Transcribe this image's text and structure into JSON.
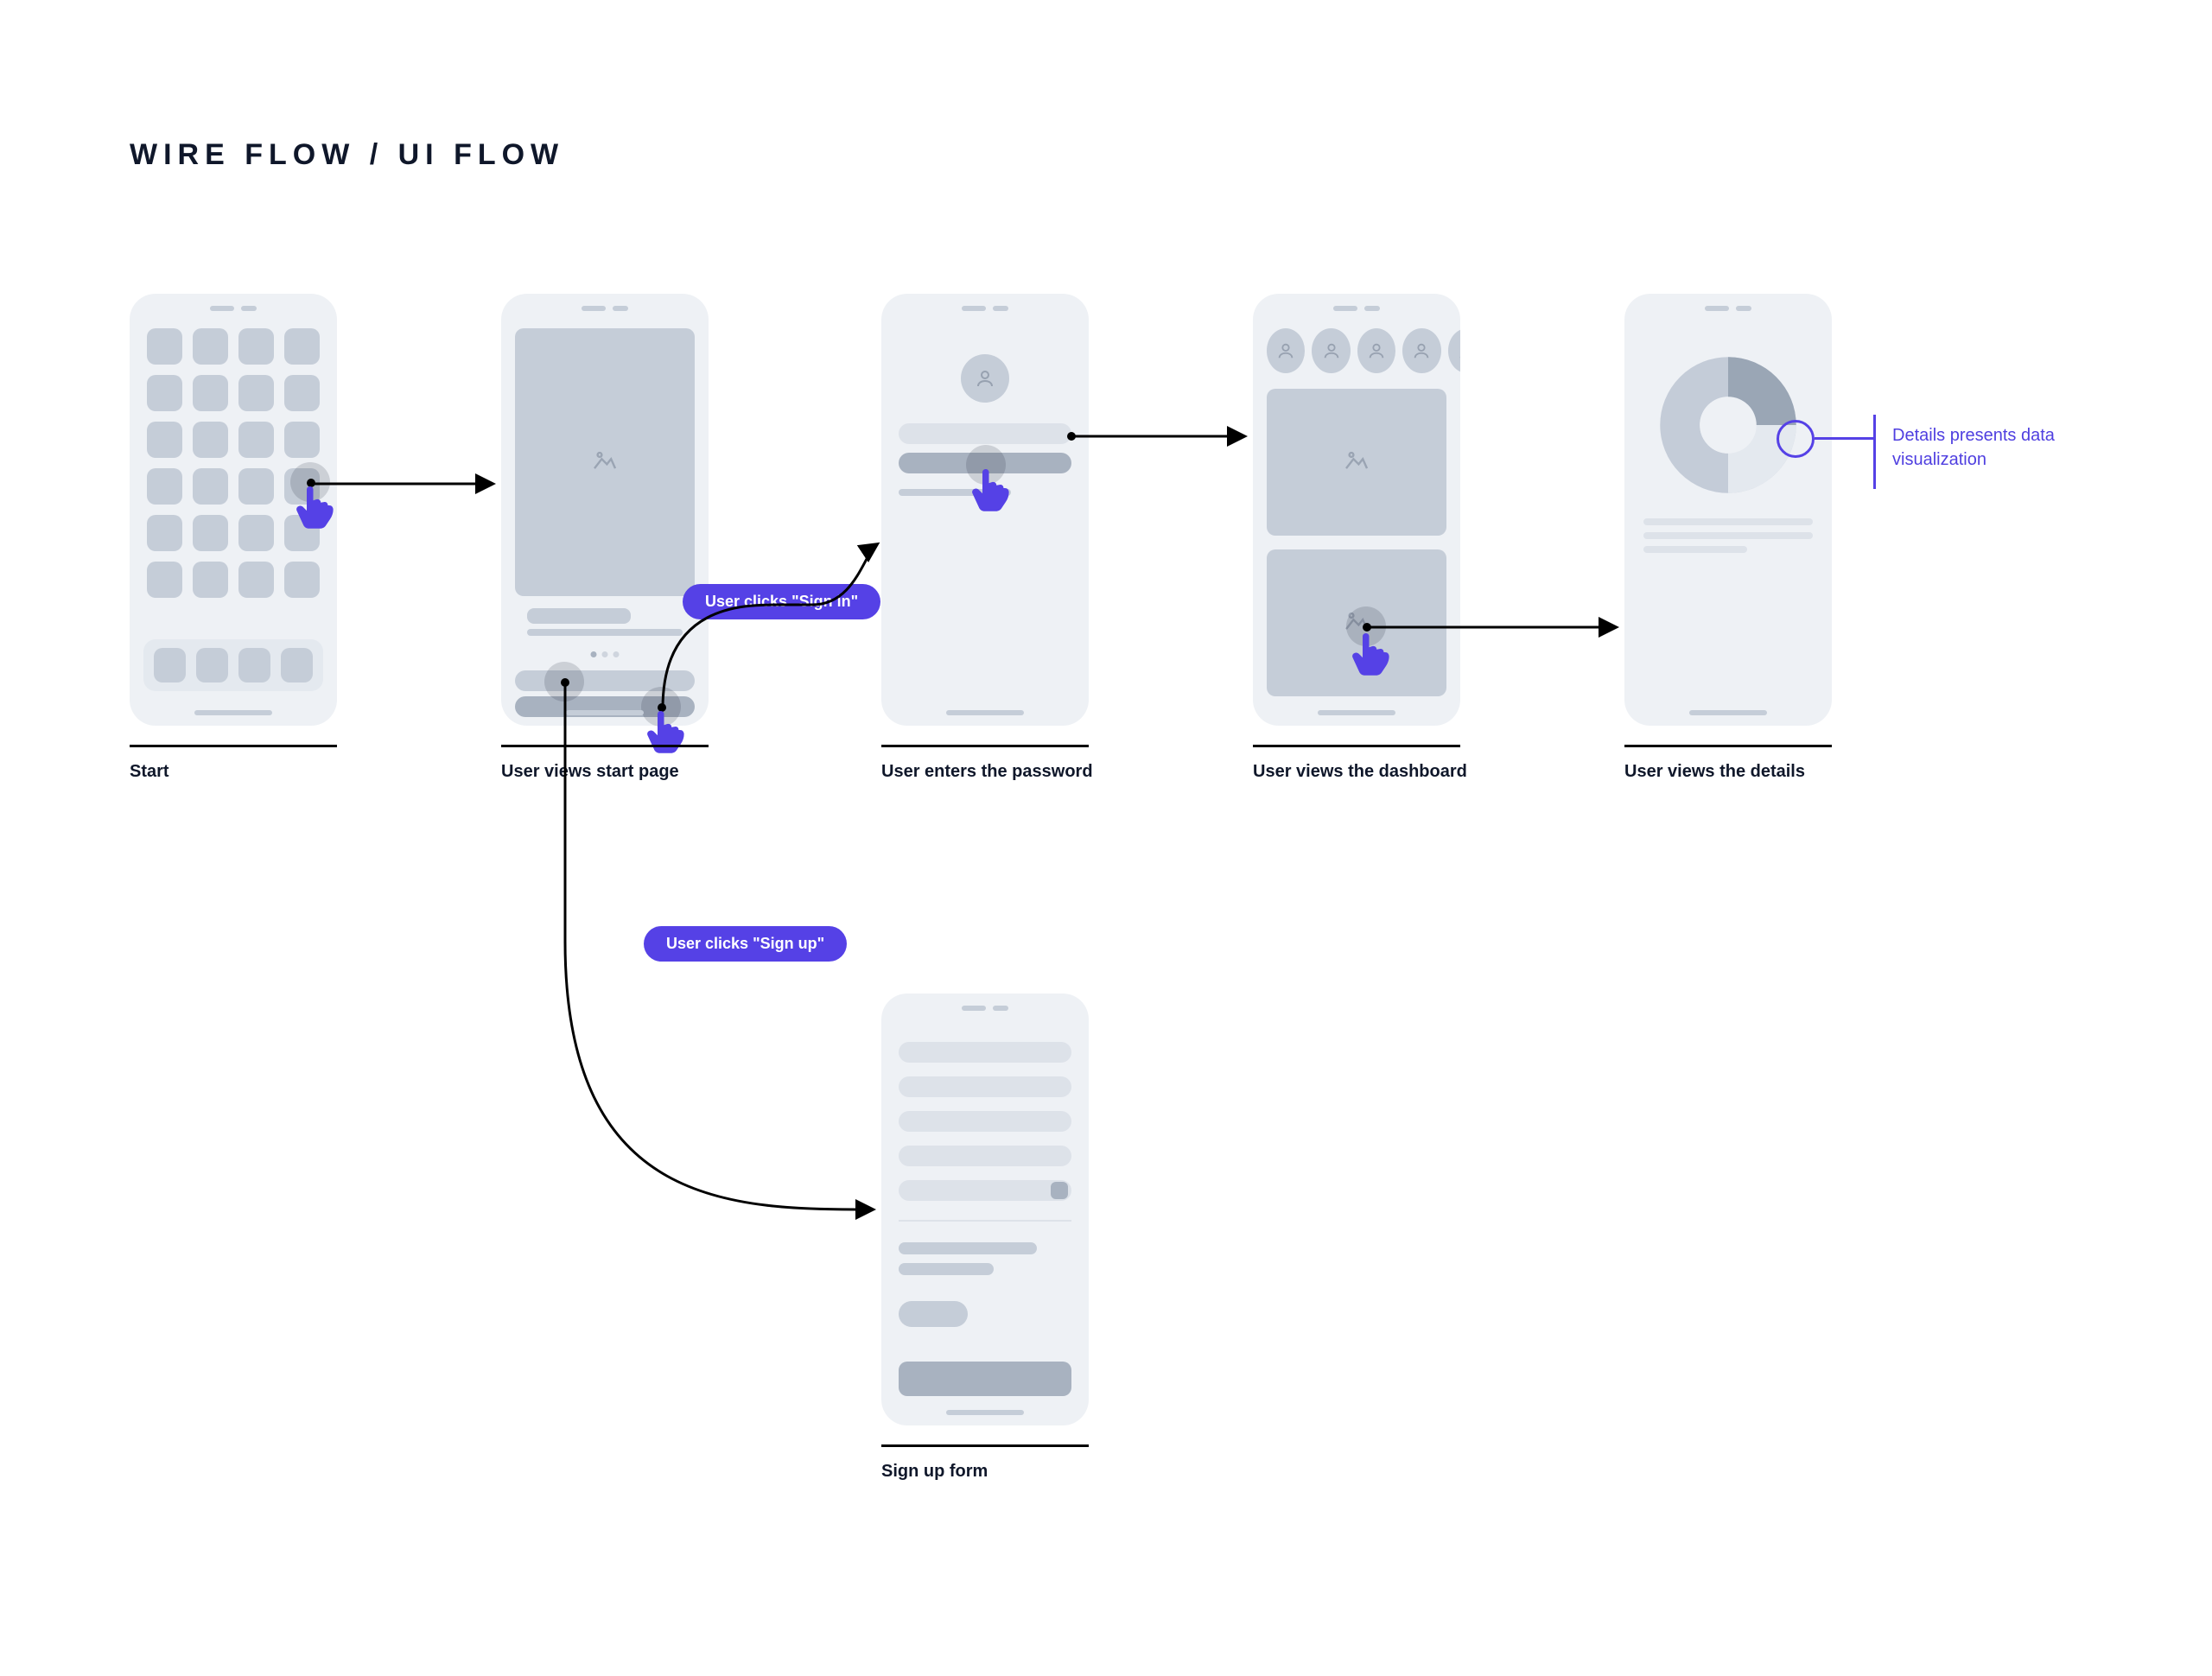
{
  "title": "WIRE FLOW / UI FLOW",
  "screens": {
    "s1": "Start",
    "s2": "User views start page",
    "s3": "User enters the password",
    "s4": "User views  the dashboard",
    "s5": "User views  the details",
    "s6": "Sign up form"
  },
  "actions": {
    "signin": "User clicks \"Sign in\"",
    "signup": "User clicks \"Sign up\""
  },
  "annotation": {
    "details": "Details presents data visualization"
  },
  "chart_data": {
    "type": "pie",
    "title": "",
    "values": [
      25,
      25,
      50
    ],
    "colors": [
      "#9aa6b5",
      "#e4e9ef",
      "#c4ccd8"
    ],
    "donut_hole": true
  }
}
